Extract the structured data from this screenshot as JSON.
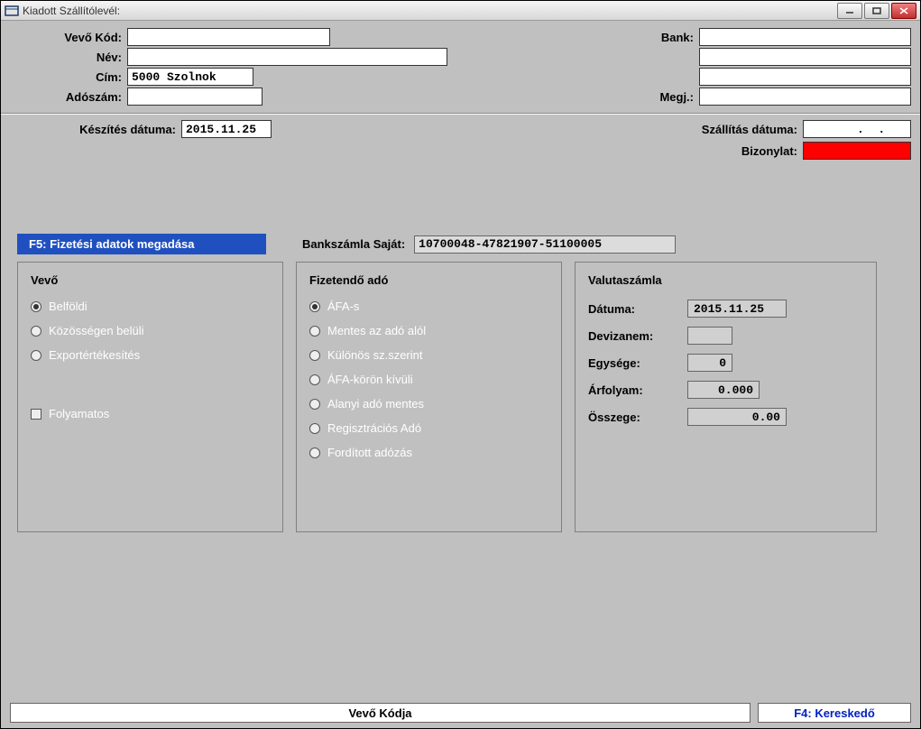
{
  "window": {
    "title": "Kiadott Szállítólevél:"
  },
  "header": {
    "labels": {
      "vevo_kod": "Vevő  Kód:",
      "nev": "Név:",
      "cim": "Cím:",
      "adoszam": "Adószám:",
      "bank": "Bank:",
      "megj": "Megj.:",
      "keszites": "Készítés dátuma:",
      "szallitas": "Szállítás dátuma:",
      "bizonylat": "Bizonylat:"
    },
    "values": {
      "vevo_kod": "",
      "nev": "",
      "cim": "5000 Szolnok",
      "adoszam": "",
      "bank": "",
      "bank2": "",
      "bank3": "",
      "megj": "",
      "keszites": "2015.11.25",
      "szallitas": "    .  .",
      "bizonylat": ""
    }
  },
  "tab": {
    "f5_label": "F5: Fizetési adatok megadása",
    "bank_label": "Bankszámla Saját:",
    "bank_value": "10700048-47821907-51100005"
  },
  "panel_vevo": {
    "title": "Vevő",
    "options": {
      "belfoldi": "Belföldi",
      "kozossegen": "Közösségen belüli",
      "export": "Exportértékesítés"
    },
    "folyamatos": "Folyamatos"
  },
  "panel_ado": {
    "title": "Fizetendő adó",
    "options": {
      "afas": "ÁFA-s",
      "mentes": "Mentes az adó alól",
      "kulonos": "Különös sz.szerint",
      "afakoron": "ÁFA-körön kívüli",
      "alanyi": "Alanyi adó mentes",
      "regisztracio": "Regisztrációs Adó",
      "forditott": "Fordított adózás"
    }
  },
  "panel_valuta": {
    "title": "Valutaszámla",
    "labels": {
      "datuma": "Dátuma:",
      "devizanem": "Devizanem:",
      "egysege": "Egysége:",
      "arfolyam": "Árfolyam:",
      "osszege": "Összege:"
    },
    "values": {
      "datuma": "2015.11.25",
      "devizanem": "",
      "egysege": "0",
      "arfolyam": "0.000",
      "osszege": "0.00"
    }
  },
  "footer": {
    "vevo_kodja": "Vevő Kódja",
    "f4": "F4: Kereskedő"
  }
}
